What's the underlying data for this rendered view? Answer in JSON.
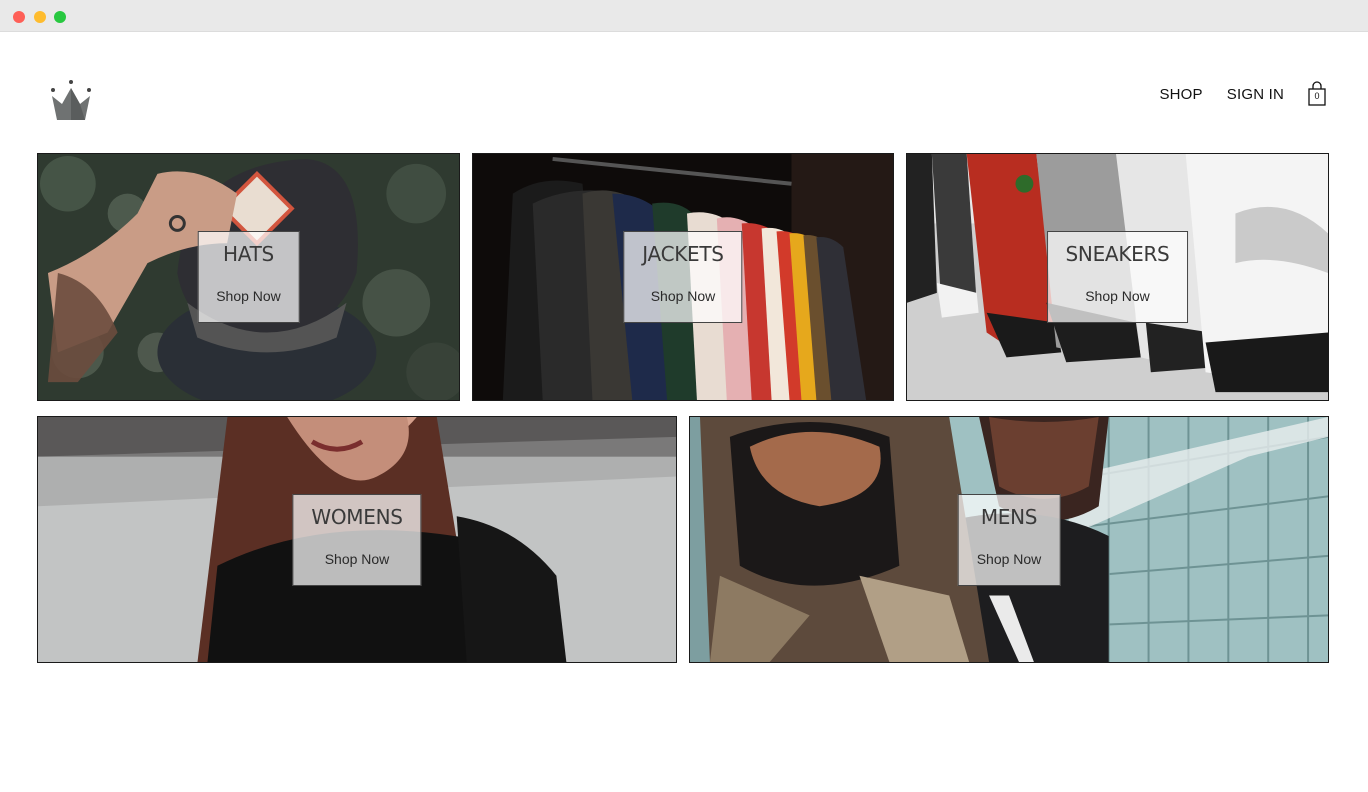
{
  "window": {
    "controls": [
      "close",
      "minimize",
      "zoom"
    ]
  },
  "header": {
    "logo_icon": "crown-icon",
    "nav": {
      "shop_label": "SHOP",
      "signin_label": "SIGN IN",
      "cart_icon": "shopping-bag-icon",
      "cart_count": "0"
    }
  },
  "directory": {
    "items": [
      {
        "title": "HATS",
        "cta": "Shop Now",
        "image": "man-in-cap-photo"
      },
      {
        "title": "JACKETS",
        "cta": "Shop Now",
        "image": "jackets-on-rack-photo"
      },
      {
        "title": "SNEAKERS",
        "cta": "Shop Now",
        "image": "sneakers-on-shelf-photo"
      },
      {
        "title": "WOMENS",
        "cta": "Shop Now",
        "image": "woman-portrait-photo"
      },
      {
        "title": "MENS",
        "cta": "Shop Now",
        "image": "man-portrait-photo"
      }
    ]
  },
  "colors": {
    "text": "#111111",
    "tile_border": "#1a1a1a",
    "label_bg": "#ffffffb8"
  }
}
